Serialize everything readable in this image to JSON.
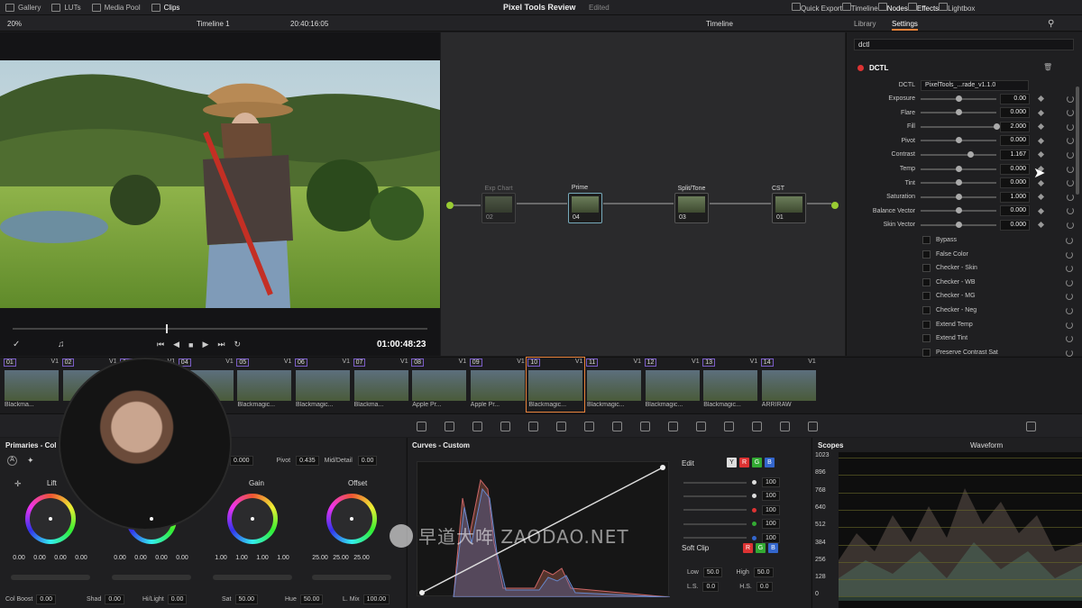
{
  "topbar": {
    "left_items": [
      "Gallery",
      "LUTs",
      "Media Pool",
      "Clips"
    ],
    "project_title": "Pixel Tools Review",
    "project_status": "Edited",
    "right_items": [
      "Quick Export",
      "Timeline",
      "Nodes",
      "Effects",
      "Lightbox"
    ]
  },
  "viewer": {
    "zoom": "20%",
    "timeline_name": "Timeline 1",
    "timecode": "20:40:16:05",
    "playback_timecode": "01:00:48:23",
    "playhead_fraction": 0.37
  },
  "node_editor": {
    "mode": "Timeline",
    "nodes": [
      {
        "label": "Exp Chart",
        "num": "02",
        "dim": true
      },
      {
        "label": "Prime",
        "num": "04",
        "selected": true
      },
      {
        "label": "Split/Tone",
        "num": "03"
      },
      {
        "label": "CST",
        "num": "01"
      }
    ]
  },
  "settings": {
    "tabs": [
      "Library",
      "Settings"
    ],
    "search_value": "dctl",
    "section_title": "DCTL",
    "dctl_label": "DCTL",
    "dctl_value": "PixelTools_...rade_v1.1.0",
    "params": [
      {
        "label": "Exposure",
        "value": "0.00",
        "level": 0.5
      },
      {
        "label": "Flare",
        "value": "0.000",
        "level": 0.5
      },
      {
        "label": "Fill",
        "value": "2.000",
        "level": 1.0
      },
      {
        "label": "Pivot",
        "value": "0.000",
        "level": 0.5
      },
      {
        "label": "Contrast",
        "value": "1.167",
        "level": 0.65
      },
      {
        "label": "Temp",
        "value": "0.000",
        "level": 0.5
      },
      {
        "label": "Tint",
        "value": "0.000",
        "level": 0.5
      },
      {
        "label": "Saturation",
        "value": "1.000",
        "level": 0.5
      },
      {
        "label": "Balance Vector",
        "value": "0.000",
        "level": 0.5
      },
      {
        "label": "Skin Vector",
        "value": "0.000",
        "level": 0.5
      }
    ],
    "checkboxes": [
      "Bypass",
      "False Color",
      "Checker - Skin",
      "Checker - WB",
      "Checker - MG",
      "Checker - Neg",
      "Extend Temp",
      "Extend Tint",
      "Preserve Contrast Sat"
    ]
  },
  "clips": [
    {
      "num": "01",
      "track": "V1",
      "name": "Blackma..."
    },
    {
      "num": "02",
      "track": "V1",
      "name": ""
    },
    {
      "num": "03",
      "track": "V1",
      "name": ""
    },
    {
      "num": "04",
      "track": "V1",
      "name": ""
    },
    {
      "num": "05",
      "track": "V1",
      "name": "Blackmagic..."
    },
    {
      "num": "06",
      "track": "V1",
      "name": "Blackmagic..."
    },
    {
      "num": "07",
      "track": "V1",
      "name": "Blackma..."
    },
    {
      "num": "08",
      "track": "V1",
      "name": "Apple Pr..."
    },
    {
      "num": "09",
      "track": "V1",
      "name": "Apple Pr..."
    },
    {
      "num": "10",
      "track": "V1",
      "name": "Blackmagic..."
    },
    {
      "num": "11",
      "track": "V1",
      "name": "Blackmagic..."
    },
    {
      "num": "12",
      "track": "V1",
      "name": "Blackmagic..."
    },
    {
      "num": "13",
      "track": "V1",
      "name": "Blackmagic..."
    },
    {
      "num": "14",
      "track": "V1",
      "name": "ARRIRAW"
    }
  ],
  "primaries": {
    "title": "Primaries - Col",
    "top_fields": {
      "contrast_value": "0.000",
      "pivot_label": "Pivot",
      "pivot_value": "0.435",
      "middetail_label": "Mid/Detail",
      "middetail_value": "0.00"
    },
    "wheels": [
      {
        "label": "Lift",
        "values": [
          "0.00",
          "0.00",
          "0.00",
          "0.00"
        ]
      },
      {
        "label": "",
        "values": [
          "0.00",
          "0.00",
          "0.00",
          "0.00"
        ]
      },
      {
        "label": "Gain",
        "values": [
          "1.00",
          "1.00",
          "1.00",
          "1.00"
        ]
      },
      {
        "label": "Offset",
        "values": [
          "25.00",
          "25.00",
          "25.00",
          ""
        ]
      }
    ],
    "bottom": [
      {
        "label": "Col Boost",
        "value": "0.00"
      },
      {
        "label": "Shad",
        "value": "0.00"
      },
      {
        "label": "Hi/Light",
        "value": "0.00"
      },
      {
        "label": "Sat",
        "value": "50.00"
      },
      {
        "label": "Hue",
        "value": "50.00"
      },
      {
        "label": "L. Mix",
        "value": "100.00"
      }
    ]
  },
  "curves": {
    "title": "Curves - Custom",
    "edit_label": "Edit",
    "channels": [
      "Y",
      "R",
      "G",
      "B"
    ],
    "channel_values": [
      "100",
      "100",
      "100",
      "100",
      "100"
    ],
    "softclip_label": "Soft Clip",
    "low_label": "Low",
    "low_value": "50.0",
    "high_label": "High",
    "high_value": "50.0",
    "ls_label": "L.S.",
    "ls_value": "0.0",
    "hs_label": "H.S.",
    "hs_value": "0.0"
  },
  "scopes": {
    "title": "Scopes",
    "mode": "Waveform",
    "ticks": [
      "1023",
      "896",
      "768",
      "640",
      "512",
      "384",
      "256",
      "128",
      "0"
    ]
  },
  "watermark": "早道大哖 ZAODAO.NET",
  "colors": {
    "accent": "#e8823a",
    "selection": "#7a5cc7",
    "red": "#d33",
    "green": "#3a3",
    "blue": "#36c"
  }
}
